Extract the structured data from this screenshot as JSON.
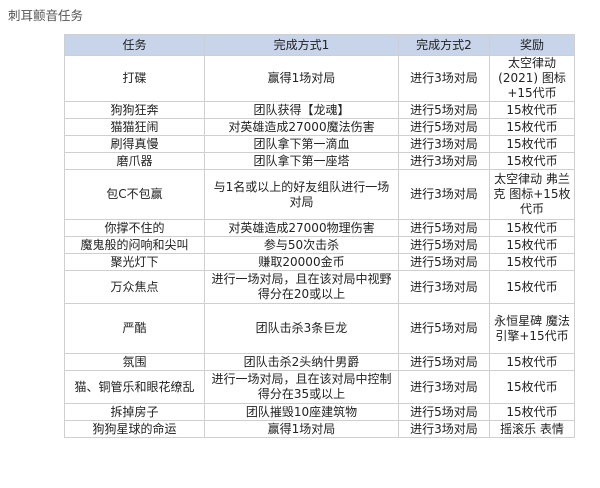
{
  "page": {
    "title": "刺耳颤音任务"
  },
  "table": {
    "headers": [
      "任务",
      "完成方式1",
      "完成方式2",
      "奖励"
    ],
    "rows": [
      {
        "task": "打碟",
        "method1": "赢得1场对局",
        "method2": "进行3场对局",
        "reward": "太空律动(2021) 图标+15代币"
      },
      {
        "task": "狗狗狂奔",
        "method1": "团队获得【龙魂】",
        "method2": "进行5场对局",
        "reward": "15枚代币"
      },
      {
        "task": "猫猫狂闹",
        "method1": "对英雄造成27000魔法伤害",
        "method2": "进行5场对局",
        "reward": "15枚代币"
      },
      {
        "task": "刷得真慢",
        "method1": "团队拿下第一滴血",
        "method2": "进行3场对局",
        "reward": "15枚代币"
      },
      {
        "task": "磨爪器",
        "method1": "团队拿下第一座塔",
        "method2": "进行3场对局",
        "reward": "15枚代币"
      },
      {
        "task": "包C不包赢",
        "method1": "与1名或以上的好友组队进行一场对局",
        "method2": "进行3场对局",
        "reward": "太空律动 弗兰克 图标+15枚代币"
      },
      {
        "task": "你撑不住的",
        "method1": "对英雄造成27000物理伤害",
        "method2": "进行5场对局",
        "reward": "15枚代币"
      },
      {
        "task": "魔鬼般的闷响和尖叫",
        "method1": "参与50次击杀",
        "method2": "进行5场对局",
        "reward": "15枚代币"
      },
      {
        "task": "聚光灯下",
        "method1": "赚取20000金币",
        "method2": "进行5场对局",
        "reward": "15枚代币"
      },
      {
        "task": "万众焦点",
        "method1": "进行一场对局，且在该对局中视野得分在20或以上",
        "method2": "进行3场对局",
        "reward": "15枚代币"
      },
      {
        "task": "严酷",
        "method1": "团队击杀3条巨龙",
        "method2": "进行5场对局",
        "reward": "永恒星碑 魔法引擎+15代币"
      },
      {
        "task": "氛围",
        "method1": "团队击杀2头纳什男爵",
        "method2": "进行5场对局",
        "reward": "15枚代币"
      },
      {
        "task": "猫、铜管乐和眼花缭乱",
        "method1": "进行一场对局，且在该对局中控制得分在35或以上",
        "method2": "进行3场对局",
        "reward": "15枚代币"
      },
      {
        "task": "拆掉房子",
        "method1": "团队摧毁10座建筑物",
        "method2": "进行5场对局",
        "reward": "15枚代币"
      },
      {
        "task": "狗狗星球的命运",
        "method1": "赢得1场对局",
        "method2": "进行3场对局",
        "reward": "摇滚乐 表情"
      }
    ]
  },
  "colors": {
    "header_bg": "#c7d4ea",
    "border": "#cfcfcf"
  }
}
